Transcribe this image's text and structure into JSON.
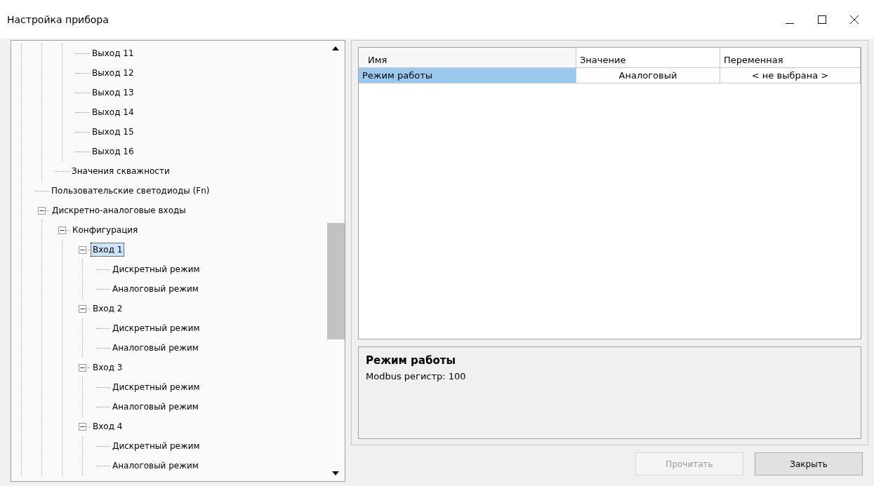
{
  "window": {
    "title": "Настройка прибора"
  },
  "tree": {
    "items": [
      {
        "children": [
          {
            "children": [
              {
                "children": [
                  {
                    "label": "Выход 11",
                    "selected": false
                  },
                  {
                    "label": "Выход 12",
                    "selected": false
                  },
                  {
                    "label": "Выход 13",
                    "selected": false
                  },
                  {
                    "label": "Выход 14",
                    "selected": false
                  },
                  {
                    "label": "Выход 15",
                    "selected": false
                  },
                  {
                    "label": "Выход 16",
                    "selected": false
                  }
                ]
              },
              {
                "label": "Значения скважности",
                "selected": false
              }
            ]
          },
          {
            "label": "Пользовательские светодиоды (Fn)",
            "selected": false
          },
          {
            "label": "Дискретно-аналоговые входы",
            "selected": false,
            "expanded": true,
            "children": [
              {
                "label": "Конфигурация",
                "selected": false,
                "expanded": true,
                "children": [
                  {
                    "label": "Вход 1",
                    "selected": true,
                    "expanded": true,
                    "children": [
                      {
                        "label": "Дискретный режим",
                        "selected": false
                      },
                      {
                        "label": "Аналоговый режим",
                        "selected": false
                      }
                    ]
                  },
                  {
                    "label": "Вход 2",
                    "selected": false,
                    "expanded": true,
                    "children": [
                      {
                        "label": "Дискретный режим",
                        "selected": false
                      },
                      {
                        "label": "Аналоговый режим",
                        "selected": false
                      }
                    ]
                  },
                  {
                    "label": "Вход 3",
                    "selected": false,
                    "expanded": true,
                    "children": [
                      {
                        "label": "Дискретный режим",
                        "selected": false
                      },
                      {
                        "label": "Аналоговый режим",
                        "selected": false
                      }
                    ]
                  },
                  {
                    "label": "Вход 4",
                    "selected": false,
                    "expanded": true,
                    "children": [
                      {
                        "label": "Дискретный режим",
                        "selected": false
                      },
                      {
                        "label": "Аналоговый режим",
                        "selected": false
                      }
                    ]
                  }
                ]
              }
            ]
          }
        ]
      }
    ]
  },
  "table": {
    "columns": [
      "Имя",
      "Значение",
      "Переменная"
    ],
    "rows": [
      {
        "selected": true,
        "cells": [
          "Режим работы",
          "Аналоговый",
          "< не выбрана >"
        ]
      }
    ]
  },
  "description": {
    "title": "Режим работы",
    "text": "Modbus регистр: 100"
  },
  "buttons": [
    {
      "label": "Прочитать",
      "disabled": true
    },
    {
      "label": "Закрыть",
      "disabled": false
    }
  ]
}
